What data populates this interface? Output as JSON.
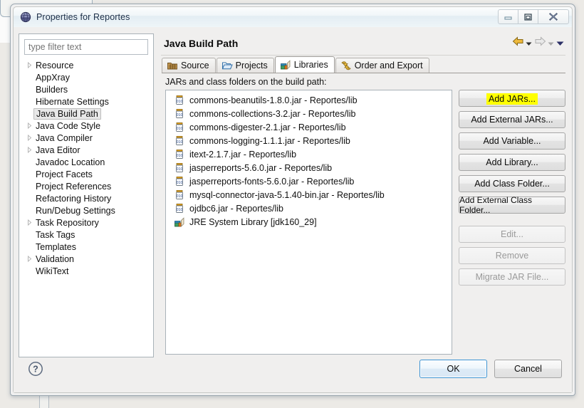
{
  "window": {
    "title": "Properties for Reportes",
    "icon": "eclipse-globe-icon",
    "minimize_label": "Minimize",
    "maximize_label": "Maximize",
    "close_label": "Close"
  },
  "sidebar": {
    "filter_placeholder": "type filter text",
    "filter_value": "",
    "items": [
      {
        "label": "Resource",
        "expandable": true,
        "selected": false
      },
      {
        "label": "AppXray",
        "expandable": false,
        "selected": false
      },
      {
        "label": "Builders",
        "expandable": false,
        "selected": false
      },
      {
        "label": "Hibernate Settings",
        "expandable": false,
        "selected": false
      },
      {
        "label": "Java Build Path",
        "expandable": false,
        "selected": true
      },
      {
        "label": "Java Code Style",
        "expandable": true,
        "selected": false
      },
      {
        "label": "Java Compiler",
        "expandable": true,
        "selected": false
      },
      {
        "label": "Java Editor",
        "expandable": true,
        "selected": false
      },
      {
        "label": "Javadoc Location",
        "expandable": false,
        "selected": false
      },
      {
        "label": "Project Facets",
        "expandable": false,
        "selected": false
      },
      {
        "label": "Project References",
        "expandable": false,
        "selected": false
      },
      {
        "label": "Refactoring History",
        "expandable": false,
        "selected": false
      },
      {
        "label": "Run/Debug Settings",
        "expandable": false,
        "selected": false
      },
      {
        "label": "Task Repository",
        "expandable": true,
        "selected": false
      },
      {
        "label": "Task Tags",
        "expandable": false,
        "selected": false
      },
      {
        "label": "Templates",
        "expandable": false,
        "selected": false
      },
      {
        "label": "Validation",
        "expandable": true,
        "selected": false
      },
      {
        "label": "WikiText",
        "expandable": false,
        "selected": false
      }
    ]
  },
  "main": {
    "page_title": "Java Build Path",
    "nav": {
      "back_icon": "back-arrow-icon",
      "back_menu_icon": "chevron-down-icon",
      "forward_icon": "forward-arrow-icon",
      "forward_menu_icon": "chevron-down-icon",
      "view_menu_icon": "chevron-down-icon"
    },
    "tabs": [
      {
        "label": "Source",
        "icon": "source-package-icon",
        "active": false
      },
      {
        "label": "Projects",
        "icon": "projects-folder-icon",
        "active": false
      },
      {
        "label": "Libraries",
        "icon": "libraries-books-icon",
        "active": true
      },
      {
        "label": "Order and Export",
        "icon": "order-export-arrows-icon",
        "active": false
      }
    ],
    "list_caption": "JARs and class folders on the build path:",
    "entries": [
      {
        "label": "commons-beanutils-1.8.0.jar - Reportes/lib",
        "icon": "jar-icon"
      },
      {
        "label": "commons-collections-3.2.jar - Reportes/lib",
        "icon": "jar-icon"
      },
      {
        "label": "commons-digester-2.1.jar - Reportes/lib",
        "icon": "jar-icon"
      },
      {
        "label": "commons-logging-1.1.1.jar - Reportes/lib",
        "icon": "jar-icon"
      },
      {
        "label": "itext-2.1.7.jar - Reportes/lib",
        "icon": "jar-icon"
      },
      {
        "label": "jasperreports-5.6.0.jar - Reportes/lib",
        "icon": "jar-icon"
      },
      {
        "label": "jasperreports-fonts-5.6.0.jar - Reportes/lib",
        "icon": "jar-icon"
      },
      {
        "label": "mysql-connector-java-5.1.40-bin.jar - Reportes/lib",
        "icon": "jar-icon"
      },
      {
        "label": "ojdbc6.jar - Reportes/lib",
        "icon": "jar-icon"
      },
      {
        "label": "JRE System Library [jdk160_29]",
        "icon": "libraries-books-icon"
      }
    ],
    "buttons": [
      {
        "label": "Add JARs...",
        "enabled": true,
        "highlighted": true
      },
      {
        "label": "Add External JARs...",
        "enabled": true,
        "highlighted": false
      },
      {
        "label": "Add Variable...",
        "enabled": true,
        "highlighted": false
      },
      {
        "label": "Add Library...",
        "enabled": true,
        "highlighted": false
      },
      {
        "label": "Add Class Folder...",
        "enabled": true,
        "highlighted": false
      },
      {
        "label": "Add External Class Folder...",
        "enabled": true,
        "highlighted": false
      },
      {
        "label": "Edit...",
        "enabled": false,
        "highlighted": false
      },
      {
        "label": "Remove",
        "enabled": false,
        "highlighted": false
      },
      {
        "label": "Migrate JAR File...",
        "enabled": false,
        "highlighted": false
      }
    ]
  },
  "footer": {
    "help_icon": "help-question-icon",
    "ok_label": "OK",
    "cancel_label": "Cancel"
  },
  "colors": {
    "highlight": "#ffff00",
    "default_button_border": "#3c93d3",
    "title_text": "#1d2f48"
  }
}
